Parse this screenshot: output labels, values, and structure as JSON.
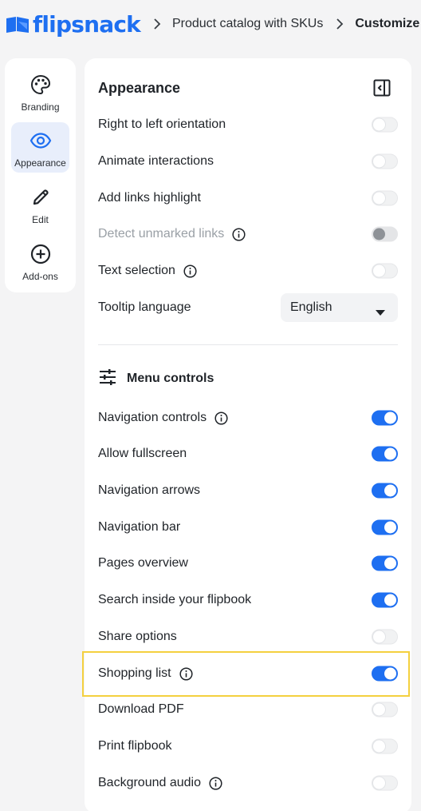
{
  "header": {
    "logo_text": "flipsnack",
    "breadcrumb": [
      "Product catalog with SKUs",
      "Customize"
    ]
  },
  "rail": {
    "items": [
      {
        "label": "Branding",
        "icon": "palette-icon",
        "active": false
      },
      {
        "label": "Appearance",
        "icon": "eye-icon",
        "active": true
      },
      {
        "label": "Edit",
        "icon": "pencil-icon",
        "active": false
      },
      {
        "label": "Add-ons",
        "icon": "plus-circle-icon",
        "active": false
      }
    ]
  },
  "panel": {
    "title": "Appearance",
    "settings": [
      {
        "label": "Right to left orientation",
        "info": false,
        "state": "off"
      },
      {
        "label": "Animate interactions",
        "info": false,
        "state": "off"
      },
      {
        "label": "Add links highlight",
        "info": false,
        "state": "off"
      },
      {
        "label": "Detect unmarked links",
        "info": true,
        "state": "disabled"
      },
      {
        "label": "Text selection",
        "info": true,
        "state": "off"
      }
    ],
    "tooltip_language": {
      "label": "Tooltip language",
      "value": "English"
    },
    "menu_controls": {
      "title": "Menu controls",
      "items": [
        {
          "label": "Navigation controls",
          "info": true,
          "state": "on"
        },
        {
          "label": "Allow fullscreen",
          "info": false,
          "state": "on"
        },
        {
          "label": "Navigation arrows",
          "info": false,
          "state": "on"
        },
        {
          "label": "Navigation bar",
          "info": false,
          "state": "on"
        },
        {
          "label": "Pages overview",
          "info": false,
          "state": "on"
        },
        {
          "label": "Search inside your flipbook",
          "info": false,
          "state": "on"
        },
        {
          "label": "Share options",
          "info": false,
          "state": "off"
        },
        {
          "label": "Shopping list",
          "info": true,
          "state": "on"
        },
        {
          "label": "Download PDF",
          "info": false,
          "state": "off"
        },
        {
          "label": "Print flipbook",
          "info": false,
          "state": "off"
        },
        {
          "label": "Background audio",
          "info": true,
          "state": "off"
        }
      ]
    }
  },
  "colors": {
    "accent": "#1e6ff1",
    "highlight": "#f4d03f",
    "background": "#f4f4f5"
  }
}
